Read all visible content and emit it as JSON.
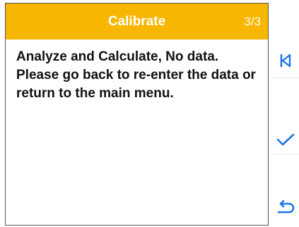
{
  "header": {
    "title": "Calibrate",
    "step": "3/3"
  },
  "message": "Analyze and Calculate, No data. Please go back to re-enter the data or return to the main menu.",
  "side_buttons": [
    {
      "icon": "skip-back-icon"
    },
    {
      "icon": "checkmark-icon"
    },
    {
      "icon": "return-icon"
    }
  ],
  "colors": {
    "header_bg": "#f7b600",
    "header_text": "#ffffff",
    "accent": "#1e73e8"
  }
}
